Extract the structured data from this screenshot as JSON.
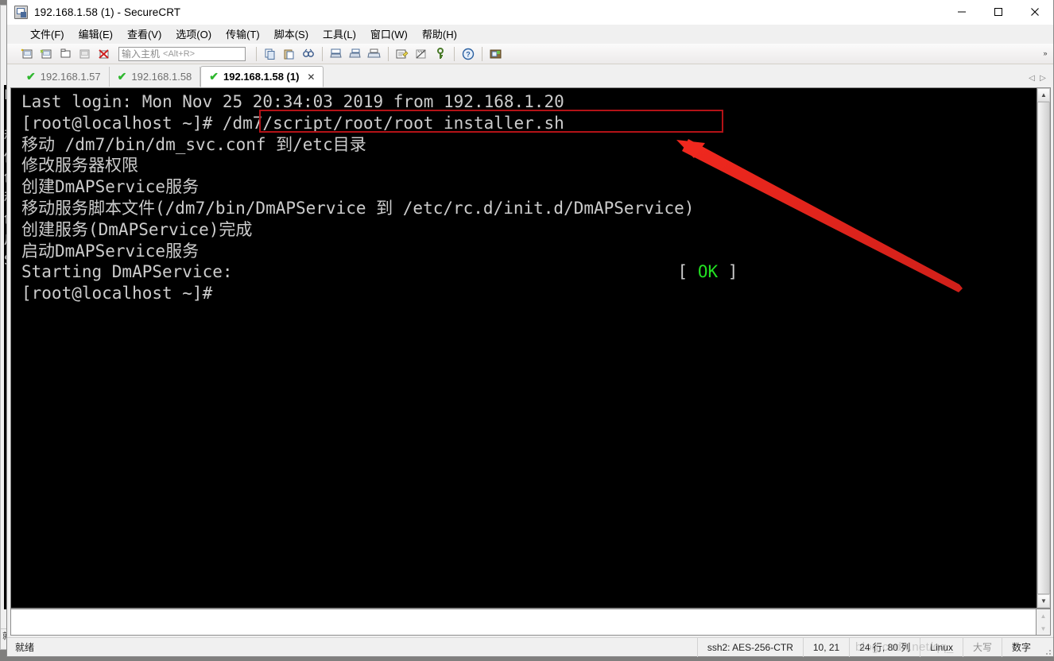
{
  "window": {
    "title": "192.168.1.58 (1) - SecureCRT",
    "icon": "app-icon",
    "minimize": "—",
    "maximize": "☐",
    "close": "✕"
  },
  "menubar": {
    "items": [
      {
        "label": "文件(F)",
        "name": "menu-file"
      },
      {
        "label": "编辑(E)",
        "name": "menu-edit"
      },
      {
        "label": "查看(V)",
        "name": "menu-view"
      },
      {
        "label": "选项(O)",
        "name": "menu-options"
      },
      {
        "label": "传输(T)",
        "name": "menu-transfer"
      },
      {
        "label": "脚本(S)",
        "name": "menu-script"
      },
      {
        "label": "工具(L)",
        "name": "menu-tools"
      },
      {
        "label": "窗口(W)",
        "name": "menu-window"
      },
      {
        "label": "帮助(H)",
        "name": "menu-help"
      }
    ]
  },
  "toolbar": {
    "host_placeholder": "输入主机",
    "host_hint": "<Alt+R>",
    "host_value": "",
    "overflow": "»",
    "buttons": [
      {
        "name": "new-session-icon",
        "glyph": "❐"
      },
      {
        "name": "clone-session-icon",
        "glyph": "❐"
      },
      {
        "name": "new-tab-icon",
        "glyph": "▭"
      },
      {
        "name": "connect-sftp-icon",
        "glyph": "❐"
      },
      {
        "name": "disconnect-icon",
        "glyph": "✖"
      },
      {
        "name": "copy-icon",
        "glyph": "⎘"
      },
      {
        "name": "paste-icon",
        "glyph": "⎗"
      },
      {
        "name": "find-icon",
        "glyph": "⚲"
      },
      {
        "name": "print-screen-icon",
        "glyph": "⎙"
      },
      {
        "name": "log-session-icon",
        "glyph": "⎙"
      },
      {
        "name": "print-icon",
        "glyph": "⎙"
      },
      {
        "name": "session-options-icon",
        "glyph": "✎"
      },
      {
        "name": "global-options-icon",
        "glyph": "✦"
      },
      {
        "name": "key-icon",
        "glyph": "⚷"
      },
      {
        "name": "help-icon",
        "glyph": "?"
      },
      {
        "name": "session-manager-icon",
        "glyph": "▣"
      }
    ]
  },
  "tabs": {
    "check_glyph": "✔",
    "close_glyph": "✕",
    "prev_glyph": "◁",
    "next_glyph": "▷",
    "items": [
      {
        "label": "192.168.1.57",
        "active": false
      },
      {
        "label": "192.168.1.58",
        "active": false
      },
      {
        "label": "192.168.1.58 (1)",
        "active": true
      }
    ]
  },
  "terminal": {
    "lines": [
      "Last login: Mon Nov 25 20:34:03 2019 from 192.168.1.20",
      "[root@localhost ~]# /dm7/script/root/root_installer.sh",
      "移动 /dm7/bin/dm_svc.conf 到/etc目录",
      "修改服务器权限",
      "创建DmAPService服务",
      "移动服务脚本文件(/dm7/bin/DmAPService 到 /etc/rc.d/init.d/DmAPService)",
      "创建服务(DmAPService)完成",
      "启动DmAPService服务"
    ],
    "starting_label": "Starting DmAPService:",
    "ok_open": "[",
    "ok_text": "OK",
    "ok_close": "]",
    "prompt": "[root@localhost ~]#",
    "scroll_up_glyph": "▲",
    "scroll_down_glyph": "▼"
  },
  "statusbar": {
    "ready": "就绪",
    "cipher": "ssh2: AES-256-CTR",
    "cursor": "10, 21",
    "size": "24 行, 80 列",
    "emulation": "Linux",
    "caps": "大写",
    "num": "数字"
  },
  "annotations": {
    "watermark": "blog.csdn.net/qq_",
    "redbox_label": "/dm7/script/root/root_installer.sh",
    "arrow_color": "#f0281e",
    "box_color": "#b31217"
  },
  "background_window": {
    "term_chars": "L\n[\n移\n修\n创\n移\n创\n启\nS\n[",
    "status": "1",
    "ready": "就"
  }
}
